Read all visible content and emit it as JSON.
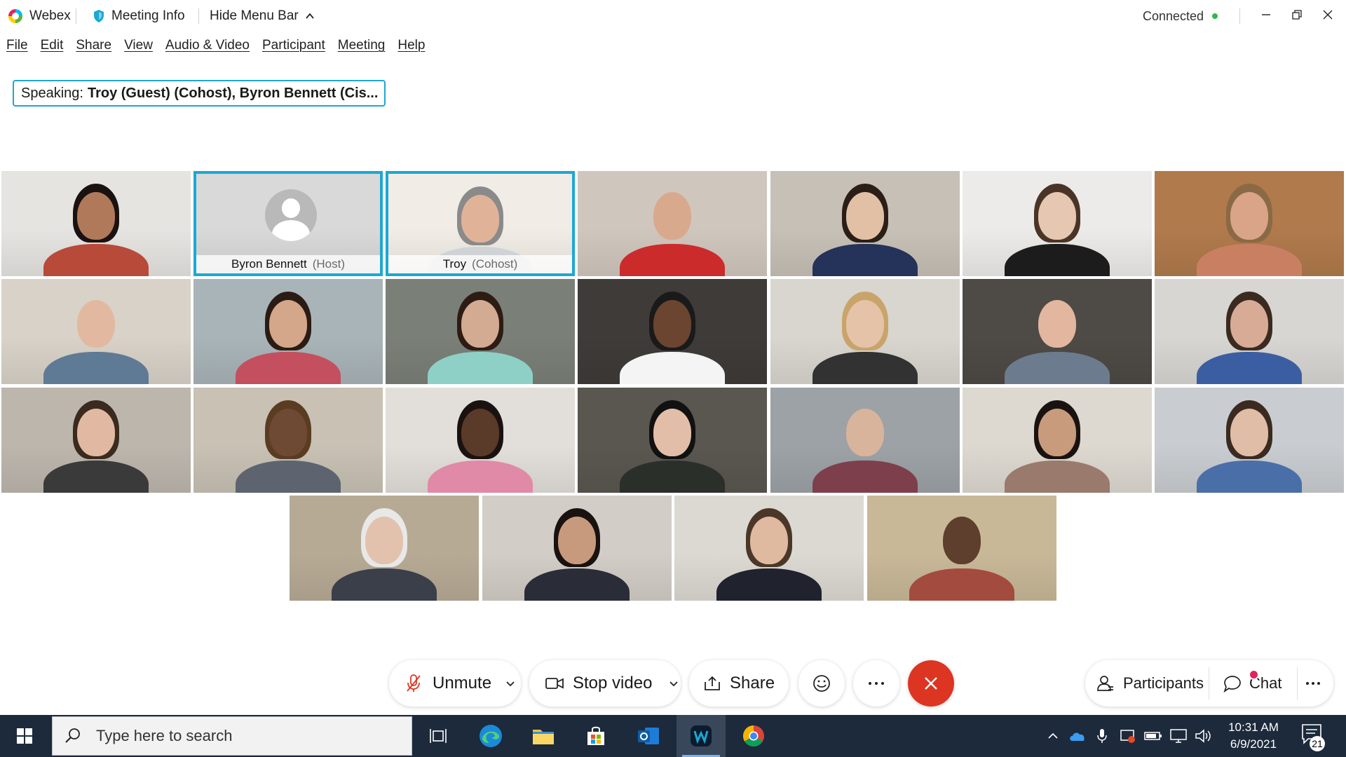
{
  "titlebar": {
    "app_name": "Webex",
    "meeting_info": "Meeting Info",
    "hide_menu": "Hide Menu Bar",
    "status": "Connected",
    "status_color": "#2fb84e"
  },
  "menu": [
    "File",
    "Edit",
    "Share",
    "View",
    "Audio & Video",
    "Participant",
    "Meeting",
    "Help"
  ],
  "speaking": {
    "label": "Speaking:",
    "names": "Troy (Guest) (Cohost), Byron Bennett (Cis..."
  },
  "participants": [
    {
      "name": "",
      "role": ""
    },
    {
      "name": "Byron Bennett",
      "role": "(Host)",
      "avatar": "default-avatar",
      "active": true
    },
    {
      "name": "Troy",
      "role": "(Cohost)",
      "active": true
    }
  ],
  "controls": {
    "unmute": "Unmute",
    "stop_video": "Stop video",
    "share": "Share",
    "participants": "Participants",
    "chat": "Chat",
    "end_color": "#dc3522",
    "accent": "#1ba8d4"
  },
  "taskbar": {
    "search_placeholder": "Type here to search",
    "time": "10:31 AM",
    "date": "6/9/2021",
    "notification_count": "21"
  }
}
